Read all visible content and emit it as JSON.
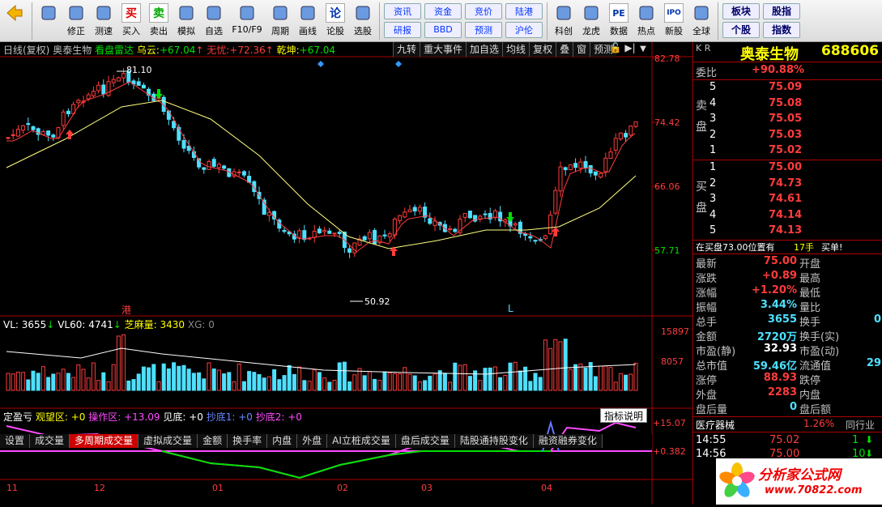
{
  "toolbar": {
    "items": [
      {
        "label": "",
        "icon": "back-arrow-icon"
      },
      {
        "label": "修正",
        "icon": "updown-arrow-icon"
      },
      {
        "label": "测速",
        "icon": "speed-icon"
      },
      {
        "label": "买入",
        "icon": "buy-icon",
        "glyph": "买"
      },
      {
        "label": "卖出",
        "icon": "sell-icon",
        "glyph": "卖"
      },
      {
        "label": "模拟",
        "icon": "gavel-icon"
      },
      {
        "label": "自选",
        "icon": "star-folder-icon"
      },
      {
        "label": "F10/F9",
        "icon": "f10-icon"
      },
      {
        "label": "周期",
        "icon": "clock-icon"
      },
      {
        "label": "画线",
        "icon": "pencil-icon"
      },
      {
        "label": "论股",
        "icon": "forum-icon",
        "glyph": "论"
      },
      {
        "label": "选股",
        "icon": "stock-pick-icon"
      }
    ],
    "square_buttons_top": [
      "资讯",
      "资金",
      "竞价",
      "陆港"
    ],
    "square_buttons_bottom": [
      "研报",
      "BBD",
      "预测",
      "沪伦"
    ],
    "items2": [
      {
        "label": "科创",
        "icon": "chart-icon"
      },
      {
        "label": "龙虎",
        "icon": "dragon-icon"
      },
      {
        "label": "数据",
        "icon": "pe-icon",
        "glyph": "PE"
      },
      {
        "label": "热点",
        "icon": "fire-icon"
      },
      {
        "label": "新股",
        "icon": "ipo-icon",
        "glyph": "IPO"
      },
      {
        "label": "全球",
        "icon": "globe-icon"
      }
    ],
    "right_top": [
      "板块",
      "股指"
    ],
    "right_bottom": [
      "个股",
      "指数"
    ]
  },
  "header": {
    "period": "日线(复权)",
    "name": "奥泰生物",
    "radar": "看盘雷达",
    "wuyun": "乌云:",
    "wuyun_val": "+67.04",
    "wuyou": "无忧:",
    "wuyou_val": "+72.36",
    "qiankun": "乾坤:",
    "qiankun_val": "+67.04",
    "buttons": [
      "九转",
      "重大事件",
      "加自选",
      "均线",
      "复权",
      "叠",
      "窗",
      "预测"
    ]
  },
  "price_axis": [
    "82.78",
    "74.42",
    "66.06",
    "57.71"
  ],
  "labels": {
    "high": "81.10",
    "low": "50.92",
    "gang": "港",
    "L": "L"
  },
  "volume": {
    "vl": "VL: 3655",
    "vl60": "VL60: 4741",
    "zhima": "芝麻量: 3430",
    "xg": "XG: 0",
    "axis": [
      "15897",
      "8057"
    ]
  },
  "tabs": [
    "设置",
    "成交量",
    "多周期成交量",
    "虚拟成交量",
    "金额",
    "换手率",
    "内盘",
    "外盘",
    "AI立桩成交量",
    "盘后成交量",
    "陆股通持股变化",
    "融资融券变化"
  ],
  "active_tab": "多周期成交量",
  "indicator": {
    "name": "定盈亏",
    "a": "观望区: +0",
    "b": "操作区: +13.09",
    "c": "见底: +0",
    "d": "抄底1: +0",
    "e": "抄底2: +0",
    "help": "指标说明",
    "axis": [
      "+15.07",
      "+0.382"
    ]
  },
  "dates": [
    "11",
    "12",
    "01",
    "02",
    "03",
    "04"
  ],
  "right": {
    "kr": "K R",
    "stock_name": "奥泰生物",
    "code": "688606",
    "weibi_label": "委比",
    "weibi": "+90.88%",
    "sell_label": "卖盘",
    "buy_label": "买盘",
    "sells": [
      {
        "n": "5",
        "p": "75.09"
      },
      {
        "n": "4",
        "p": "75.08"
      },
      {
        "n": "3",
        "p": "75.05"
      },
      {
        "n": "2",
        "p": "75.03"
      },
      {
        "n": "1",
        "p": "75.02"
      }
    ],
    "buys": [
      {
        "n": "1",
        "p": "75.00"
      },
      {
        "n": "2",
        "p": "74.73"
      },
      {
        "n": "3",
        "p": "74.61"
      },
      {
        "n": "4",
        "p": "74.14"
      },
      {
        "n": "5",
        "p": "74.13"
      }
    ],
    "zaimai": "在买盘73.00位置有",
    "zaimai_qty": "17手",
    "zaimai_tag": "买单!",
    "stats_left": [
      {
        "k": "最新",
        "v": "75.00",
        "c": "red"
      },
      {
        "k": "涨跌",
        "v": "+0.89",
        "c": "red"
      },
      {
        "k": "涨幅",
        "v": "+1.20%",
        "c": "red"
      },
      {
        "k": "振幅",
        "v": "3.44%",
        "c": "cyan"
      },
      {
        "k": "总手",
        "v": "3655",
        "c": "cyan"
      },
      {
        "k": "金额",
        "v": "2720万",
        "c": "cyan"
      },
      {
        "k": "市盈(静)",
        "v": "32.93",
        "c": "wht"
      },
      {
        "k": "总市值",
        "v": "59.46亿",
        "c": "cyan"
      },
      {
        "k": "涨停",
        "v": "88.93",
        "c": "red"
      },
      {
        "k": "外盘",
        "v": "2283",
        "c": "red"
      },
      {
        "k": "盘后量",
        "v": "0",
        "c": "cyan"
      }
    ],
    "stats_right": [
      {
        "k": "开盘",
        "v": ""
      },
      {
        "k": "最高",
        "v": ""
      },
      {
        "k": "最低",
        "v": ""
      },
      {
        "k": "量比",
        "v": ""
      },
      {
        "k": "换手",
        "v": "0"
      },
      {
        "k": "换手(实)",
        "v": ""
      },
      {
        "k": "市盈(动)",
        "v": ""
      },
      {
        "k": "流通值",
        "v": "29"
      },
      {
        "k": "跌停",
        "v": ""
      },
      {
        "k": "内盘",
        "v": ""
      },
      {
        "k": "盘后额",
        "v": ""
      }
    ],
    "sector": "医疗器械",
    "sector_pct": "1.26%",
    "sector_tab": "同行业",
    "ticks": [
      {
        "t": "14:55",
        "p": "75.02",
        "q": "1"
      },
      {
        "t": "14:56",
        "p": "75.00",
        "q": "10"
      }
    ]
  },
  "watermark": {
    "text": "分析家公式网",
    "url": "www.70822.com"
  },
  "colors": {
    "red": "#ff3c3c",
    "green": "#00e000",
    "cyan": "#4ee0ff",
    "yellow": "#ffff00"
  }
}
